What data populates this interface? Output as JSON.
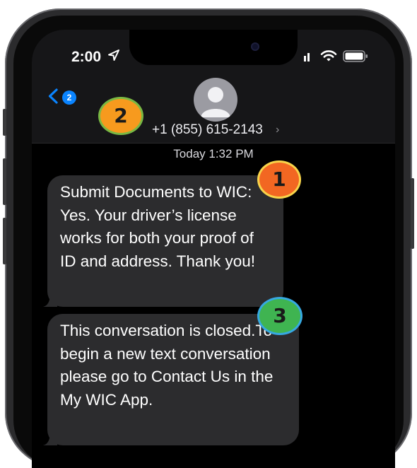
{
  "status_bar": {
    "time": "2:00"
  },
  "header": {
    "back_badge_count": "2",
    "contact_number": "+1 (855) 615-2143",
    "chevron": "›"
  },
  "conversation": {
    "timestamp": "Today 1:32 PM",
    "messages": [
      {
        "text": "Submit Documents to WIC: Yes. Your driver’s license works for both your proof of ID and address. Thank you!"
      },
      {
        "text": "This conversation is closed.To begin a new text conversation please go to Contact Us in the My WIC App."
      }
    ]
  },
  "annotations": [
    {
      "label": "1",
      "color": "#f26722"
    },
    {
      "label": "2",
      "color": "#f79a1e"
    },
    {
      "label": "3",
      "color": "#3fb451"
    }
  ],
  "colors": {
    "accent": "#0a84ff",
    "bubble": "#2c2c2e",
    "screen": "#000000"
  },
  "icons": [
    "location-arrow-icon",
    "signal-icon",
    "wifi-icon",
    "battery-icon",
    "back-chevron-icon",
    "avatar-person-icon"
  ]
}
